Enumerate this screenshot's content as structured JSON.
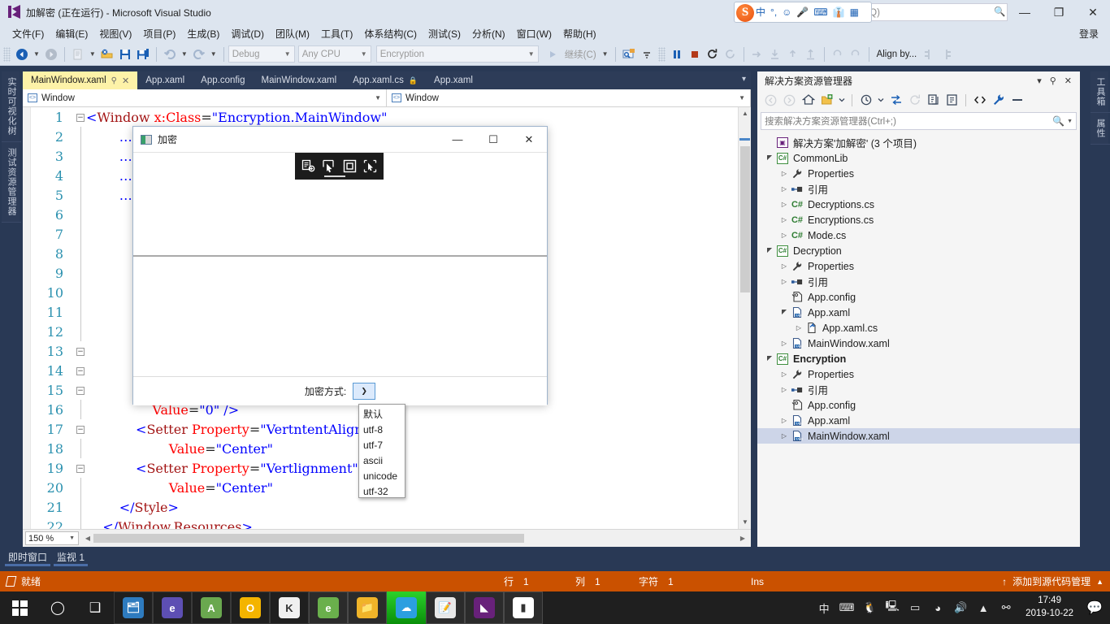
{
  "window": {
    "title": "加解密 (正在运行) - Microsoft Visual Studio",
    "minimize": "—",
    "maximize": "❐",
    "close": "✕"
  },
  "quick_launch": {
    "placeholder": "(Ctrl+Q)",
    "text": "项 (Ctrl+Q)"
  },
  "ime": {
    "lang": "中",
    "tone": "°,",
    "emoji": "☺",
    "mic": "🎤",
    "keyboard": "⌨",
    "skin": "👔",
    "apps": "▦",
    "logo": "S"
  },
  "menu": {
    "items": [
      "文件(F)",
      "编辑(E)",
      "视图(V)",
      "项目(P)",
      "生成(B)",
      "调试(D)",
      "团队(M)",
      "工具(T)",
      "体系结构(C)",
      "测试(S)",
      "分析(N)",
      "窗口(W)",
      "帮助(H)"
    ],
    "signin": "登录"
  },
  "toolbar": {
    "config": "Debug",
    "platform": "Any CPU",
    "startup_project": "Encryption",
    "continue": "继续(C)",
    "align": "Align by...",
    "back_title": "后退",
    "forward_title": "前进"
  },
  "left_tabs": [
    "实时可视化树",
    "测试资源管理器"
  ],
  "right_tabs": [
    "工具箱",
    "属性"
  ],
  "editor": {
    "tabs": [
      {
        "label": "MainWindow.xaml",
        "active": true,
        "pinned": true,
        "closable": true
      },
      {
        "label": "App.xaml",
        "active": false
      },
      {
        "label": "App.config",
        "active": false
      },
      {
        "label": "MainWindow.xaml",
        "active": false
      },
      {
        "label": "App.xaml.cs",
        "active": false,
        "locked": true
      },
      {
        "label": "App.xaml",
        "active": false
      }
    ],
    "nav_left": "Window",
    "nav_right": "Window",
    "zoom": "150 %",
    "lines": [
      {
        "n": 1,
        "fold": "minus",
        "segments": [
          {
            "t": "<",
            "c": "br"
          },
          {
            "t": "Window",
            "c": "tag"
          },
          {
            "t": " ",
            "c": "pl"
          },
          {
            "t": "x:Class",
            "c": "attr"
          },
          {
            "t": "=",
            "c": "pl"
          },
          {
            "t": "\"Encryption.MainWindow\"",
            "c": "val"
          }
        ]
      },
      {
        "n": 2,
        "fold": "bar",
        "segments": [
          {
            "t": "        ",
            "c": "pl"
          },
          {
            "t": "…06/xaml/presentation\"",
            "c": "val"
          }
        ]
      },
      {
        "n": 3,
        "fold": "bar",
        "segments": [
          {
            "t": "        ",
            "c": "pl"
          },
          {
            "t": "…2006/xaml\"",
            "c": "val"
          }
        ]
      },
      {
        "n": 4,
        "fold": "bar",
        "segments": [
          {
            "t": "        ",
            "c": "pl"
          },
          {
            "t": "…sion/blend/2008\"",
            "c": "val"
          }
        ]
      },
      {
        "n": 5,
        "fold": "bar",
        "segments": [
          {
            "t": "        ",
            "c": "pl"
          },
          {
            "t": "…markup-compatibility/200",
            "c": "val"
          }
        ]
      },
      {
        "n": 6,
        "fold": "bar",
        "segments": []
      },
      {
        "n": 7,
        "fold": "bar",
        "segments": []
      },
      {
        "n": 8,
        "fold": "bar",
        "segments": []
      },
      {
        "n": 9,
        "fold": "bar",
        "segments": []
      },
      {
        "n": 10,
        "fold": "bar",
        "segments": []
      },
      {
        "n": 11,
        "fold": "bar",
        "segments": []
      },
      {
        "n": 12,
        "fold": "bar",
        "segments": []
      },
      {
        "n": 13,
        "fold": "minus",
        "segments": []
      },
      {
        "n": 14,
        "fold": "minus",
        "segments": []
      },
      {
        "n": 15,
        "fold": "minus",
        "segments": []
      },
      {
        "n": 16,
        "fold": "bar",
        "segments": [
          {
            "t": "                ",
            "c": "pl"
          },
          {
            "t": "Value",
            "c": "attr"
          },
          {
            "t": "=",
            "c": "pl"
          },
          {
            "t": "\"0\"",
            "c": "val"
          },
          {
            "t": " ",
            "c": "pl"
          },
          {
            "t": "/>",
            "c": "br"
          }
        ]
      },
      {
        "n": 17,
        "fold": "minus",
        "segments": [
          {
            "t": "            ",
            "c": "pl"
          },
          {
            "t": "<",
            "c": "br"
          },
          {
            "t": "Setter",
            "c": "tag"
          },
          {
            "t": " ",
            "c": "pl"
          },
          {
            "t": "Property",
            "c": "attr"
          },
          {
            "t": "=",
            "c": "pl"
          },
          {
            "t": "\"Vert",
            "c": "val"
          },
          {
            "t": "ntentAlignment\"",
            "c": "val"
          }
        ]
      },
      {
        "n": 18,
        "fold": "bar",
        "segments": [
          {
            "t": "                    ",
            "c": "pl"
          },
          {
            "t": "Value",
            "c": "attr"
          },
          {
            "t": "=",
            "c": "pl"
          },
          {
            "t": "\"Center\"",
            "c": "val"
          }
        ]
      },
      {
        "n": 19,
        "fold": "minus",
        "segments": [
          {
            "t": "            ",
            "c": "pl"
          },
          {
            "t": "<",
            "c": "br"
          },
          {
            "t": "Setter",
            "c": "tag"
          },
          {
            "t": " ",
            "c": "pl"
          },
          {
            "t": "Property",
            "c": "attr"
          },
          {
            "t": "=",
            "c": "pl"
          },
          {
            "t": "\"Vert",
            "c": "val"
          },
          {
            "t": "lignment\"",
            "c": "val"
          }
        ]
      },
      {
        "n": 20,
        "fold": "bar",
        "segments": [
          {
            "t": "                    ",
            "c": "pl"
          },
          {
            "t": "Value",
            "c": "attr"
          },
          {
            "t": "=",
            "c": "pl"
          },
          {
            "t": "\"Center\"",
            "c": "val"
          }
        ]
      },
      {
        "n": 21,
        "fold": "bar",
        "segments": [
          {
            "t": "        ",
            "c": "pl"
          },
          {
            "t": "</",
            "c": "br"
          },
          {
            "t": "Style",
            "c": "tag"
          },
          {
            "t": ">",
            "c": "br"
          }
        ]
      },
      {
        "n": 22,
        "fold": "bar",
        "segments": [
          {
            "t": "    ",
            "c": "pl"
          },
          {
            "t": "</",
            "c": "br"
          },
          {
            "t": "Window.Resources",
            "c": "tag"
          },
          {
            "t": ">",
            "c": "br"
          }
        ]
      }
    ]
  },
  "dock_tabs": [
    {
      "label": "即时窗口",
      "selected": true
    },
    {
      "label": "监视 1",
      "selected": true
    }
  ],
  "dialog": {
    "title": "加密",
    "minimize": "—",
    "maximize": "☐",
    "close": "✕",
    "mode_label": "加密方式:",
    "mode_value": "",
    "dropdown_options": [
      "默认",
      "utf-8",
      "utf-7",
      "ascii",
      "unicode",
      "utf-32"
    ]
  },
  "adorner": {
    "buttons": [
      "go-to-live-visual-tree-icon",
      "enable-selection-icon",
      "display-layout-adorner-icon",
      "track-focused-element-icon"
    ]
  },
  "solution_explorer": {
    "title": "解决方案资源管理器",
    "header_buttons": [
      "chevron-down",
      "pin",
      "close"
    ],
    "toolbar_icons": [
      "back-icon",
      "forward-icon",
      "home-icon",
      "pending-changes-icon",
      "dropdown-icon",
      "sync-with-active-doc-icon",
      "refresh-icon",
      "collapse-all-icon",
      "show-all-files-icon",
      "properties-icon",
      "view-code-icon",
      "preview-icon"
    ],
    "search_placeholder": "搜索解决方案资源管理器(Ctrl+;)",
    "tree": [
      {
        "depth": 0,
        "label": "解决方案'加解密' (3 个项目)",
        "icon": "solution",
        "arrow": "none"
      },
      {
        "depth": 0,
        "label": "CommonLib",
        "icon": "csproj",
        "arrow": "open"
      },
      {
        "depth": 1,
        "label": "Properties",
        "icon": "wrench",
        "arrow": "closed"
      },
      {
        "depth": 1,
        "label": "引用",
        "icon": "reference",
        "arrow": "closed"
      },
      {
        "depth": 1,
        "label": "Decryptions.cs",
        "icon": "cs",
        "arrow": "closed"
      },
      {
        "depth": 1,
        "label": "Encryptions.cs",
        "icon": "cs",
        "arrow": "closed"
      },
      {
        "depth": 1,
        "label": "Mode.cs",
        "icon": "cs",
        "arrow": "closed"
      },
      {
        "depth": 0,
        "label": "Decryption",
        "icon": "csproj",
        "arrow": "open"
      },
      {
        "depth": 1,
        "label": "Properties",
        "icon": "wrench",
        "arrow": "closed"
      },
      {
        "depth": 1,
        "label": "引用",
        "icon": "reference",
        "arrow": "closed"
      },
      {
        "depth": 1,
        "label": "App.config",
        "icon": "config",
        "arrow": "none"
      },
      {
        "depth": 1,
        "label": "App.xaml",
        "icon": "xaml",
        "arrow": "open"
      },
      {
        "depth": 2,
        "label": "App.xaml.cs",
        "icon": "xamlcs",
        "arrow": "closed"
      },
      {
        "depth": 1,
        "label": "MainWindow.xaml",
        "icon": "xaml",
        "arrow": "closed"
      },
      {
        "depth": 0,
        "label": "Encryption",
        "icon": "csproj",
        "arrow": "open",
        "bold": true
      },
      {
        "depth": 1,
        "label": "Properties",
        "icon": "wrench",
        "arrow": "closed"
      },
      {
        "depth": 1,
        "label": "引用",
        "icon": "reference",
        "arrow": "closed"
      },
      {
        "depth": 1,
        "label": "App.config",
        "icon": "config",
        "arrow": "none"
      },
      {
        "depth": 1,
        "label": "App.xaml",
        "icon": "xaml",
        "arrow": "closed"
      },
      {
        "depth": 1,
        "label": "MainWindow.xaml",
        "icon": "xaml",
        "arrow": "closed",
        "selected": true
      }
    ]
  },
  "statusbar": {
    "state": "就绪",
    "row_label": "行",
    "row": "1",
    "col_label": "列",
    "col": "1",
    "char_label": "字符",
    "char": "1",
    "ins": "Ins",
    "source_control": "添加到源代码管理",
    "up_arrow": "↑",
    "caret": "▲"
  },
  "taskbar": {
    "start": "start-button",
    "apps": [
      {
        "name": "cortana-icon",
        "glyph": "◯",
        "bg": "transparent",
        "state": "sys"
      },
      {
        "name": "task-view-icon",
        "glyph": "❑",
        "bg": "transparent",
        "state": "sys"
      },
      {
        "name": "store-icon",
        "glyph": "🗂",
        "bg": "#2e7bbf",
        "state": "pinned"
      },
      {
        "name": "firefox-icon",
        "glyph": "e",
        "bg": "#5d4fb3",
        "state": "pinned"
      },
      {
        "name": "android-studio-icon",
        "glyph": "A",
        "bg": "#6aa84f",
        "state": "pinned"
      },
      {
        "name": "chrome-icon",
        "glyph": "O",
        "bg": "#f4b400",
        "state": "pinned"
      },
      {
        "name": "kugou-icon",
        "glyph": "K",
        "bg": "#f0f0f0",
        "state": "pinned"
      },
      {
        "name": "browser-icon",
        "glyph": "e",
        "bg": "#6ab04c",
        "state": "run"
      },
      {
        "name": "file-explorer-icon",
        "glyph": "📁",
        "bg": "#f0b429",
        "state": "run"
      },
      {
        "name": "onedrive-icon",
        "glyph": "☁",
        "bg": "#2b9fe0",
        "state": "active"
      },
      {
        "name": "notepad-icon",
        "glyph": "📝",
        "bg": "#e8e8e8",
        "state": "run"
      },
      {
        "name": "vscode-icon",
        "glyph": "◣",
        "bg": "#68217a",
        "state": "run"
      },
      {
        "name": "visual-studio-icon",
        "glyph": "▮",
        "bg": "#ffffff",
        "state": "run"
      }
    ],
    "tray": [
      {
        "name": "people-icon",
        "glyph": "⚯"
      },
      {
        "name": "show-hidden-icons-icon",
        "glyph": "▲"
      },
      {
        "name": "volume-icon",
        "glyph": "🔊"
      },
      {
        "name": "wechat-icon",
        "glyph": "◕"
      },
      {
        "name": "battery-icon",
        "glyph": "▭"
      },
      {
        "name": "network-icon",
        "glyph": "🖳"
      },
      {
        "name": "qq-icon",
        "glyph": "🐧"
      },
      {
        "name": "touch-keyboard-icon",
        "glyph": "⌨"
      },
      {
        "name": "ime-chinese-icon",
        "glyph": "中"
      }
    ],
    "time": "17:49",
    "date": "2019-10-22",
    "action_center": "💬"
  }
}
